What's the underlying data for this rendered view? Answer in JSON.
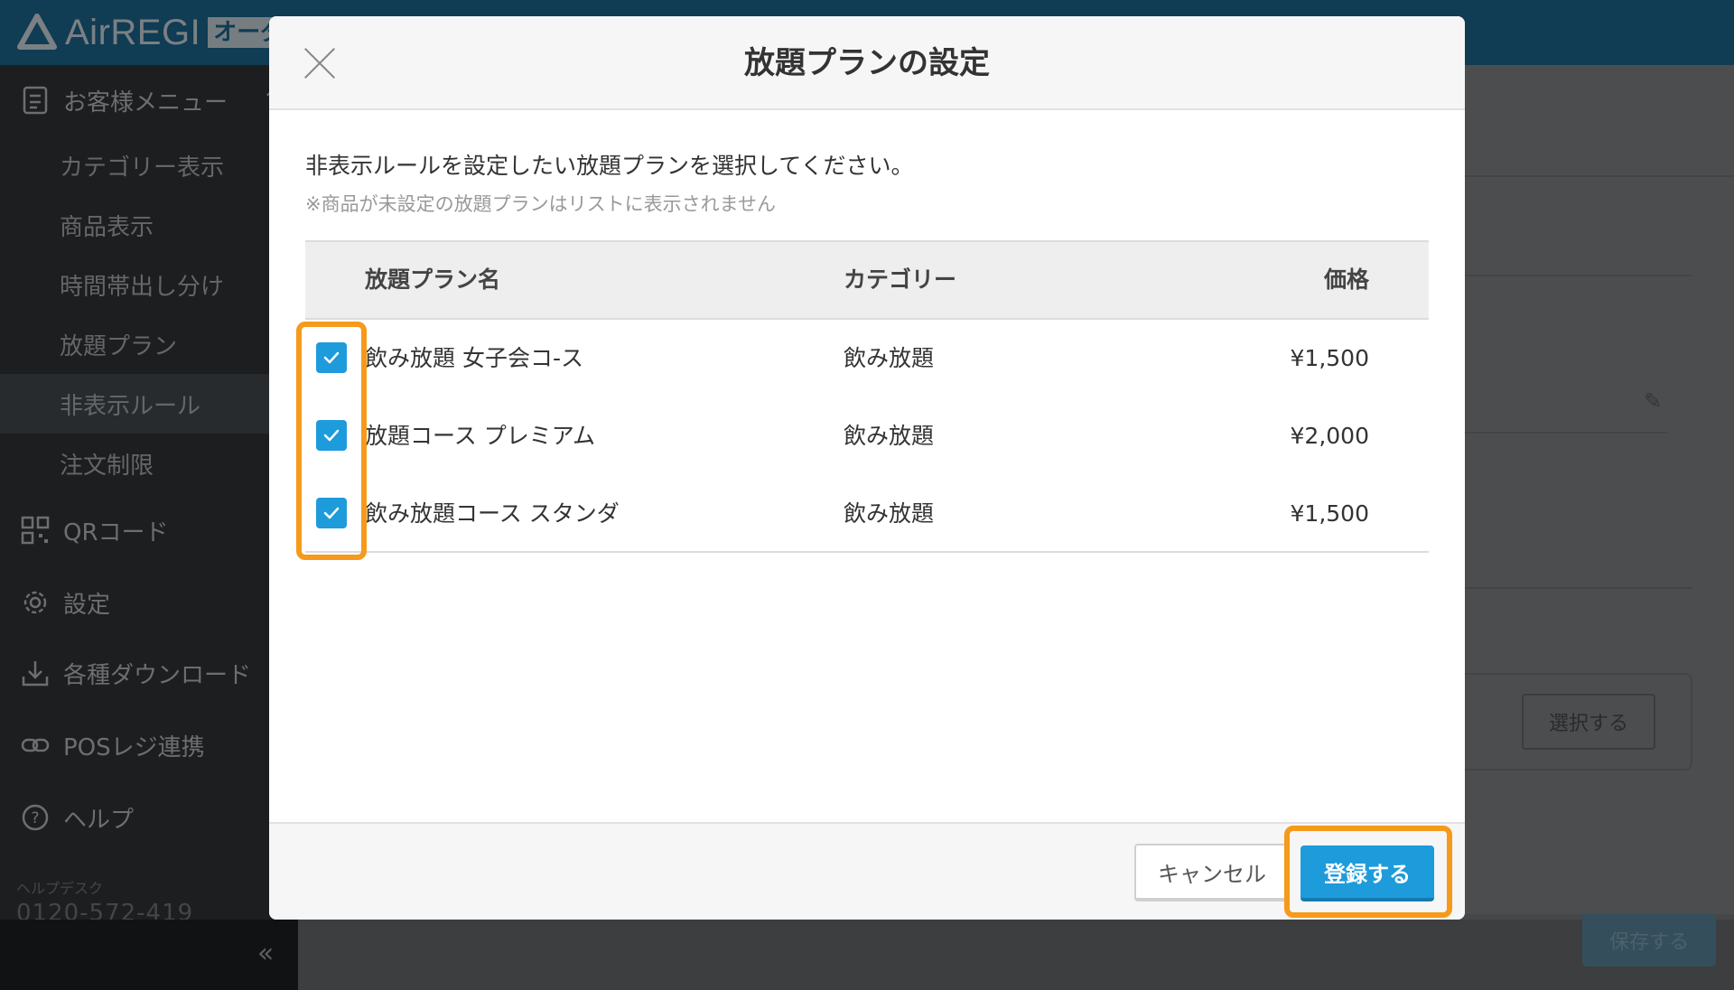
{
  "app": {
    "logo_text": "AirREGI",
    "logo_badge": "オーダ"
  },
  "sidebar": {
    "groups": [
      {
        "label": "お客様メニュー",
        "icon": "menu-book-icon"
      },
      {
        "label": "QRコード",
        "icon": "qr-code-icon"
      },
      {
        "label": "設定",
        "icon": "gear-icon"
      },
      {
        "label": "各種ダウンロード",
        "icon": "download-icon"
      },
      {
        "label": "POSレジ連携",
        "icon": "link-icon"
      },
      {
        "label": "ヘルプ",
        "icon": "help-circle-icon"
      }
    ],
    "sub_items": [
      {
        "label": "カテゴリー表示"
      },
      {
        "label": "商品表示"
      },
      {
        "label": "時間帯出し分け"
      },
      {
        "label": "放題プラン"
      },
      {
        "label": "非表示ルール",
        "active": true
      },
      {
        "label": "注文制限"
      }
    ],
    "helpdesk_label": "ヘルプデスク",
    "helpdesk_phone": "0120-572-419",
    "collapse_label": "«"
  },
  "background": {
    "select_button": "選択する",
    "save_button": "保存する"
  },
  "modal": {
    "title": "放題プランの設定",
    "intro": "非表示ルールを設定したい放題プランを選択してください。",
    "note": "※商品が未設定の放題プランはリストに表示されません",
    "columns": {
      "name": "放題プラン名",
      "category": "カテゴリー",
      "price": "価格"
    },
    "rows": [
      {
        "name": "飲み放題 女子会コ-ス",
        "category": "飲み放題",
        "price": "¥1,500",
        "checked": true
      },
      {
        "name": "放題コース プレミアム",
        "category": "飲み放題",
        "price": "¥2,000",
        "checked": true
      },
      {
        "name": "飲み放題コース スタンダ",
        "category": "飲み放題",
        "price": "¥1,500",
        "checked": true
      }
    ],
    "cancel_label": "キャンセル",
    "submit_label": "登録する"
  },
  "colors": {
    "accent": "#1e9bdb",
    "highlight": "#f59a1a",
    "topbar": "#1e6e99",
    "sidebar": "#34383b"
  }
}
